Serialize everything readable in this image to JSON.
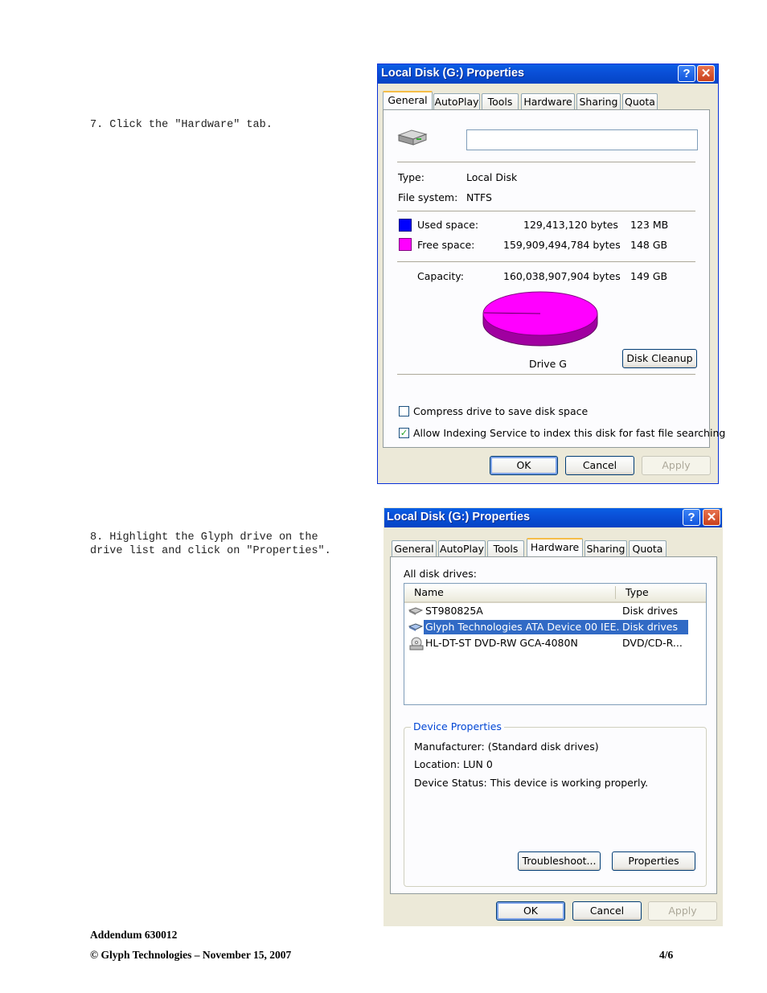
{
  "steps": {
    "step7": "7. Click the \"Hardware\" tab.",
    "step8_line1": "8. Highlight the Glyph drive on the",
    "step8_line2": "drive list and click on \"Properties\"."
  },
  "footer": {
    "addendum": "Addendum  630012",
    "copyright": "© Glyph Technologies – November 15, 2007",
    "page": "4/6"
  },
  "dialog1": {
    "title": "Local Disk (G:) Properties",
    "help_label": "?",
    "close_label": "✕",
    "tabs": [
      "General",
      "AutoPlay",
      "Tools",
      "Hardware",
      "Sharing",
      "Quota"
    ],
    "active_tab": "General",
    "name_value": "",
    "type_label": "Type:",
    "type_value": "Local Disk",
    "fs_label": "File system:",
    "fs_value": "NTFS",
    "used_label": "Used space:",
    "used_bytes": "129,413,120 bytes",
    "used_short": "123 MB",
    "free_label": "Free space:",
    "free_bytes": "159,909,494,784 bytes",
    "free_short": "148 GB",
    "cap_label": "Capacity:",
    "cap_bytes": "160,038,907,904 bytes",
    "cap_short": "149 GB",
    "drive_label": "Drive G",
    "cleanup_label": "Disk Cleanup",
    "compress_label": "Compress drive to save disk space",
    "compress_checked": false,
    "index_label": "Allow Indexing Service to index this disk for fast file searching",
    "index_checked": true,
    "ok_label": "OK",
    "cancel_label": "Cancel",
    "apply_label": "Apply",
    "used_color": "#0000ff",
    "free_color": "#ff00ff"
  },
  "dialog2": {
    "title": "Local Disk (G:) Properties",
    "help_label": "?",
    "close_label": "✕",
    "tabs": [
      "General",
      "AutoPlay",
      "Tools",
      "Hardware",
      "Sharing",
      "Quota"
    ],
    "active_tab": "Hardware",
    "all_drives_label": "All disk drives:",
    "col_name": "Name",
    "col_type": "Type",
    "drives": [
      {
        "name": "ST980825A",
        "type": "Disk drives",
        "selected": false
      },
      {
        "name": "Glyph Technologies ATA Device 00 IEE...",
        "type": "Disk drives",
        "selected": true
      },
      {
        "name": "HL-DT-ST DVD-RW GCA-4080N",
        "type": "DVD/CD-R...",
        "selected": false
      }
    ],
    "group_title": "Device Properties",
    "manufacturer": "Manufacturer: (Standard disk drives)",
    "location": "Location: LUN 0",
    "status": "Device Status: This device is working properly.",
    "troubleshoot_label": "Troubleshoot...",
    "properties_label": "Properties",
    "ok_label": "OK",
    "cancel_label": "Cancel",
    "apply_label": "Apply",
    "selection_color": "#316ac5"
  }
}
